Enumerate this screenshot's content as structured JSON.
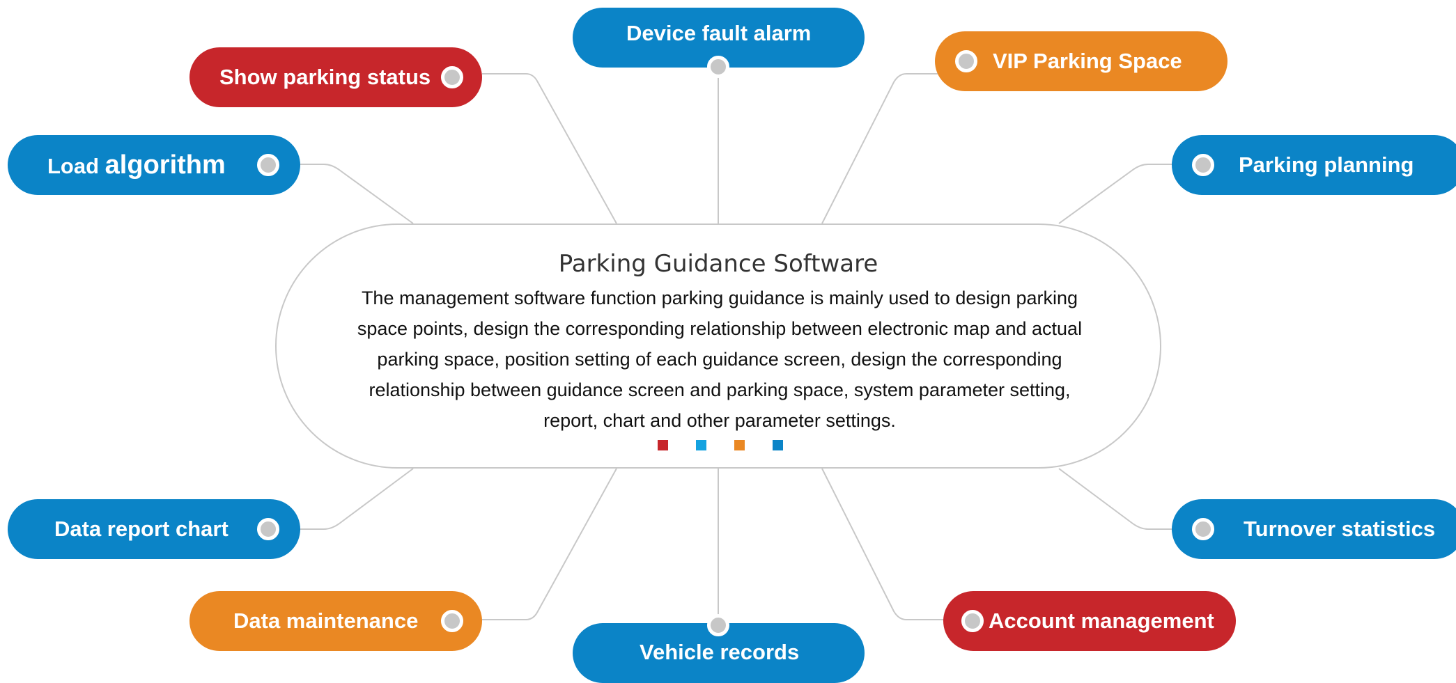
{
  "diagram": {
    "center": {
      "title": "Parking Guidance Software",
      "description": "The management software function parking guidance is mainly used to design parking space points, design the corresponding relationship between electronic map and actual parking space, position setting of each guidance screen, design the corresponding relationship between guidance screen and parking space, system parameter setting, report, chart and other parameter settings.",
      "accent_squares": [
        "#c7262b",
        "#14a2e0",
        "#ea8823",
        "#0b84c7"
      ]
    },
    "nodes": [
      {
        "id": "show-parking-status",
        "label": "Show parking status",
        "color": "#c7262b"
      },
      {
        "id": "device-fault-alarm",
        "label": "Device fault alarm",
        "color": "#0b84c7"
      },
      {
        "id": "vip-parking-space",
        "label": "VIP Parking Space",
        "color": "#ea8823"
      },
      {
        "id": "load-algorithm",
        "label_prefix": "Load ",
        "label_main": "algorithm",
        "color": "#0b84c7"
      },
      {
        "id": "parking-planning",
        "label": "Parking planning",
        "color": "#0b84c7"
      },
      {
        "id": "data-report-chart",
        "label": "Data report chart",
        "color": "#0b84c7"
      },
      {
        "id": "turnover-statistics",
        "label": "Turnover statistics",
        "color": "#0b84c7"
      },
      {
        "id": "data-maintenance",
        "label": "Data maintenance",
        "color": "#ea8823"
      },
      {
        "id": "vehicle-records",
        "label": "Vehicle records",
        "color": "#0b84c7"
      },
      {
        "id": "account-management",
        "label": "Account management",
        "color": "#c7262b"
      }
    ],
    "connector_color": "#c8c8c8",
    "dot_color": "#c7c7c7"
  }
}
